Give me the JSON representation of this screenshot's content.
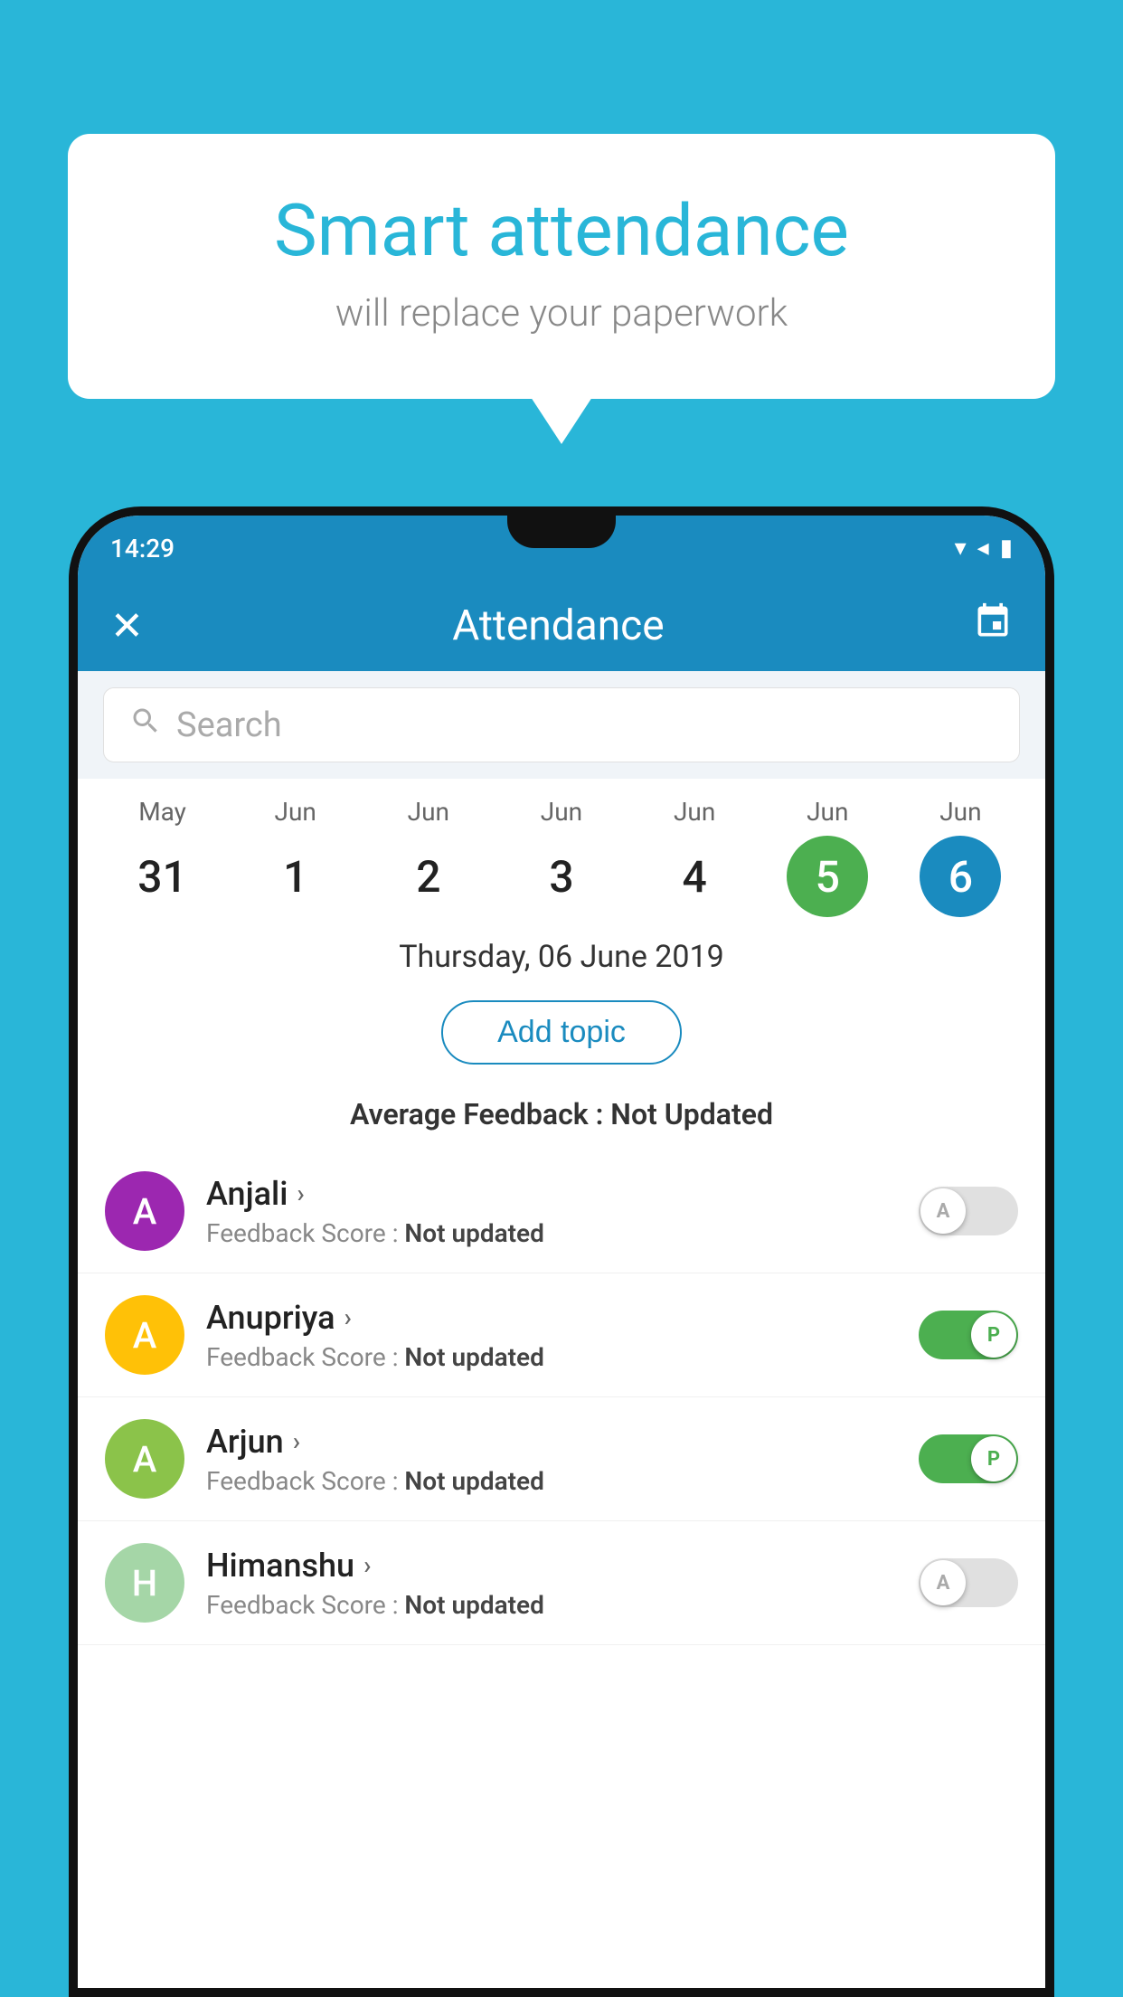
{
  "background_color": "#29b6d8",
  "speech_bubble": {
    "title": "Smart attendance",
    "subtitle": "will replace your paperwork"
  },
  "status_bar": {
    "time": "14:29",
    "wifi": "▼",
    "signal": "▲",
    "battery": "▌"
  },
  "app_header": {
    "close_label": "✕",
    "title": "Attendance",
    "calendar_icon": "📅"
  },
  "search": {
    "placeholder": "Search"
  },
  "calendar": {
    "days": [
      {
        "month": "May",
        "date": "31",
        "state": "normal"
      },
      {
        "month": "Jun",
        "date": "1",
        "state": "normal"
      },
      {
        "month": "Jun",
        "date": "2",
        "state": "normal"
      },
      {
        "month": "Jun",
        "date": "3",
        "state": "normal"
      },
      {
        "month": "Jun",
        "date": "4",
        "state": "normal"
      },
      {
        "month": "Jun",
        "date": "5",
        "state": "today"
      },
      {
        "month": "Jun",
        "date": "6",
        "state": "selected"
      }
    ]
  },
  "selected_date": "Thursday, 06 June 2019",
  "add_topic_label": "Add topic",
  "avg_feedback_label": "Average Feedback :",
  "avg_feedback_value": "Not Updated",
  "students": [
    {
      "name": "Anjali",
      "avatar_letter": "A",
      "avatar_color": "#9c27b0",
      "feedback_label": "Feedback Score :",
      "feedback_value": "Not updated",
      "toggle_state": "off",
      "toggle_letter": "A"
    },
    {
      "name": "Anupriya",
      "avatar_letter": "A",
      "avatar_color": "#ffc107",
      "feedback_label": "Feedback Score :",
      "feedback_value": "Not updated",
      "toggle_state": "on",
      "toggle_letter": "P"
    },
    {
      "name": "Arjun",
      "avatar_letter": "A",
      "avatar_color": "#8bc34a",
      "feedback_label": "Feedback Score :",
      "feedback_value": "Not updated",
      "toggle_state": "on",
      "toggle_letter": "P"
    },
    {
      "name": "Himanshu",
      "avatar_letter": "H",
      "avatar_color": "#a5d6a7",
      "feedback_label": "Feedback Score :",
      "feedback_value": "Not updated",
      "toggle_state": "off",
      "toggle_letter": "A"
    }
  ]
}
